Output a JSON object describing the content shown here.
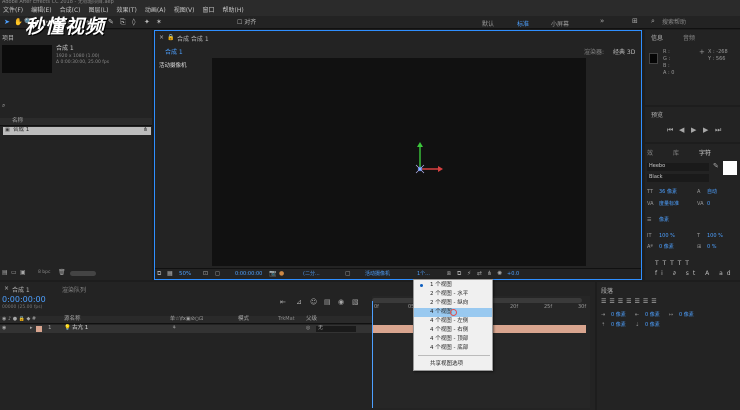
{
  "window": {
    "title": "Adobe After Effects CC 2018 - 无标题项目.aep"
  },
  "menubar": {
    "items": [
      "文件(F)",
      "编辑(E)",
      "合成(C)",
      "图层(L)",
      "效果(T)",
      "动画(A)",
      "视图(V)",
      "窗口",
      "帮助(H)"
    ]
  },
  "toolbar": {
    "snap": "对齐",
    "workspaces": [
      "默认",
      "标准",
      "小屏幕"
    ],
    "search_placeholder": "搜索帮助"
  },
  "watermark": {
    "text": "秒懂视频"
  },
  "project": {
    "title": "项目",
    "comp_name": "合成 1",
    "comp_info": "1920 x 1080 (1.00)",
    "comp_duration": "Δ 0:00:30:00, 25.00 fps",
    "col_name": "名称",
    "item": "合成 1",
    "bpc": "8 bpc"
  },
  "composition": {
    "panel_title": "合成 合成 1",
    "tab": "合成 1",
    "renderer_label": "渲染器:",
    "renderer": "经典 3D",
    "view_label": "活动摄像机",
    "zoom": "50%",
    "timecode": "0:00:00:00",
    "quality": "(二分...",
    "camera": "活动摄像机",
    "views": "1个...",
    "exposure": "+0.0"
  },
  "info": {
    "title": "信息",
    "audio": "音频",
    "r": "R :",
    "g": "G :",
    "b": "B :",
    "a": "A : 0",
    "x": "X : -268",
    "y": "Y : 566"
  },
  "preview": {
    "title": "预览"
  },
  "character": {
    "tab_effects": "效",
    "tab_lib": "库",
    "tab_char": "字符",
    "font": "Heebo",
    "style": "Black",
    "size": "36 像素",
    "leading": "自动",
    "tracking": "度量标准",
    "kerning": "0",
    "stroke": "像素",
    "v_scale": "100 %",
    "h_scale": "100 %",
    "baseline": "0 像素",
    "tsume": "0 %"
  },
  "paragraph": {
    "title": "段落",
    "indent_left": "0 像素",
    "indent_right": "0 像素",
    "indent_first": "0 像素",
    "space_before": "0 像素",
    "space_after": "0 像素"
  },
  "timeline": {
    "title": "合成 1",
    "render_queue": "渲染队列",
    "timecode": "0:00:00:00",
    "frame_info": "00000 (25.00 fps)",
    "col_source": "源名称",
    "col_mode": "模式",
    "col_trkmat": "TrkMat",
    "col_parent": "父级",
    "layer_num": "1",
    "layer_name": "古亢 1",
    "parent_value": "无",
    "ruler": [
      "0f",
      "05f",
      "10f",
      "15f",
      "20f",
      "25f",
      "30f"
    ]
  },
  "context_menu": {
    "items": [
      "1 个视图",
      "2 个视图 - 水平",
      "2 个视图 - 纵向",
      "4 个视图",
      "4 个视图 - 左侧",
      "4 个视图 - 右侧",
      "4 个视图 - 顶部",
      "4 个视图 - 底部",
      "共享视图选项"
    ],
    "selected_index": 0,
    "hover_index": 3
  },
  "colors": {
    "accent": "#2f8fff",
    "layer": "#d9a58f",
    "menu_highlight": "#99c9f0"
  },
  "axes": {
    "y": "#3cc83c",
    "x": "#d84040",
    "z": "#4a7fe0"
  }
}
